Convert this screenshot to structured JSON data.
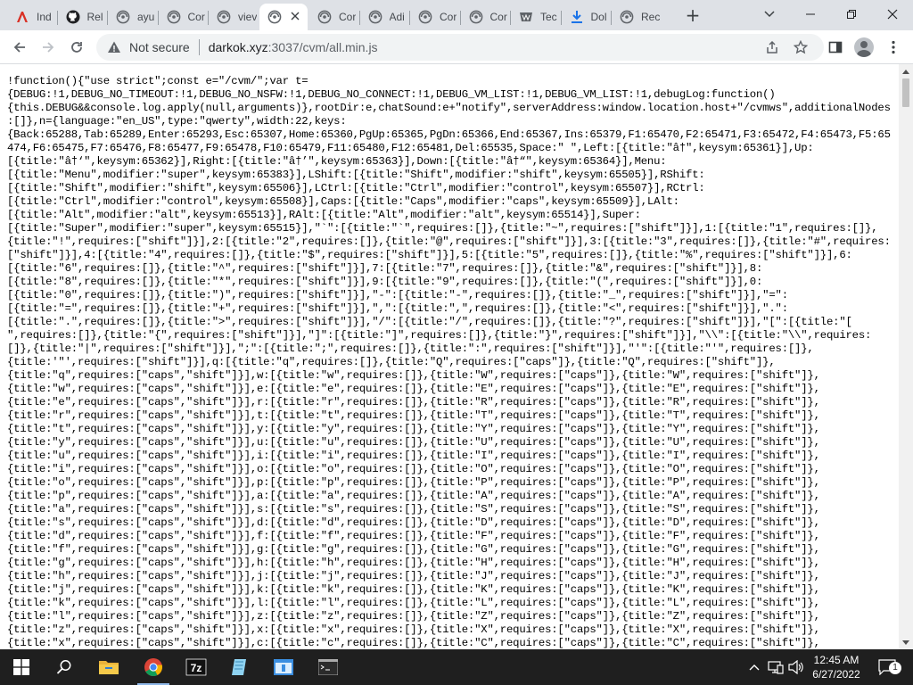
{
  "browser": {
    "tabs": [
      {
        "title": "Ind",
        "icon": "red-logo-icon",
        "active": false
      },
      {
        "title": "Rel",
        "icon": "github-icon",
        "active": false
      },
      {
        "title": "ayu",
        "icon": "globe-icon",
        "active": false
      },
      {
        "title": "Cor",
        "icon": "globe-icon",
        "active": false
      },
      {
        "title": "viev",
        "icon": "globe-icon",
        "active": false
      },
      {
        "title": "",
        "icon": "globe-icon",
        "active": true
      },
      {
        "title": "Cor",
        "icon": "globe-icon",
        "active": false
      },
      {
        "title": "Adi",
        "icon": "globe-icon",
        "active": false
      },
      {
        "title": "Cor",
        "icon": "globe-icon",
        "active": false
      },
      {
        "title": "Cor",
        "icon": "globe-icon",
        "active": false
      },
      {
        "title": "Tec",
        "icon": "tech-icon",
        "active": false
      },
      {
        "title": "Dol",
        "icon": "download-icon",
        "active": false
      },
      {
        "title": "Rec",
        "icon": "globe-icon",
        "active": false
      }
    ],
    "new_tab": "+",
    "omnibox": {
      "security_label": "Not secure",
      "url_host": "darkok.xyz",
      "url_path": ":3037/cvm/all.min.js"
    }
  },
  "content": {
    "lines": [
      "!function(){\"use strict\";const e=\"/cvm/\";var t=",
      "{DEBUG:!1,DEBUG_NO_TIMEOUT:!1,DEBUG_NO_NSFW:!1,DEBUG_NO_CONNECT:!1,DEBUG_VM_LIST:!1,DEBUG_VM_LIST:!1,debugLog:function()",
      "{this.DEBUG&&console.log.apply(null,arguments)},rootDir:e,chatSound:e+\"notify\",serverAddress:window.location.host+\"/cvmws\",additionalNodes",
      ":[]},n={language:\"en_US\",type:\"qwerty\",width:22,keys:",
      "{Back:65288,Tab:65289,Enter:65293,Esc:65307,Home:65360,PgUp:65365,PgDn:65366,End:65367,Ins:65379,F1:65470,F2:65471,F3:65472,F4:65473,F5:65",
      "474,F6:65475,F7:65476,F8:65477,F9:65478,F10:65479,F11:65480,F12:65481,Del:65535,Space:\" \",Left:[{title:\"â†\",keysym:65361}],Up:",
      "[{title:\"â†‘\",keysym:65362}],Right:[{title:\"â†’\",keysym:65363}],Down:[{title:\"â†“\",keysym:65364}],Menu:",
      "[{title:\"Menu\",modifier:\"super\",keysym:65383}],LShift:[{title:\"Shift\",modifier:\"shift\",keysym:65505}],RShift:",
      "[{title:\"Shift\",modifier:\"shift\",keysym:65506}],LCtrl:[{title:\"Ctrl\",modifier:\"control\",keysym:65507}],RCtrl:",
      "[{title:\"Ctrl\",modifier:\"control\",keysym:65508}],Caps:[{title:\"Caps\",modifier:\"caps\",keysym:65509}],LAlt:",
      "[{title:\"Alt\",modifier:\"alt\",keysym:65513}],RAlt:[{title:\"Alt\",modifier:\"alt\",keysym:65514}],Super:",
      "[{title:\"Super\",modifier:\"super\",keysym:65515}],\"`\":[{title:\"`\",requires:[]},{title:\"~\",requires:[\"shift\"]}],1:[{title:\"1\",requires:[]},",
      "{title:\"!\",requires:[\"shift\"]}],2:[{title:\"2\",requires:[]},{title:\"@\",requires:[\"shift\"]}],3:[{title:\"3\",requires:[]},{title:\"#\",requires:",
      "[\"shift\"]}],4:[{title:\"4\",requires:[]},{title:\"$\",requires:[\"shift\"]}],5:[{title:\"5\",requires:[]},{title:\"%\",requires:[\"shift\"]}],6:",
      "[{title:\"6\",requires:[]},{title:\"^\",requires:[\"shift\"]}],7:[{title:\"7\",requires:[]},{title:\"&\",requires:[\"shift\"]}],8:",
      "[{title:\"8\",requires:[]},{title:\"*\",requires:[\"shift\"]}],9:[{title:\"9\",requires:[]},{title:\"(\",requires:[\"shift\"]}],0:",
      "[{title:\"0\",requires:[]},{title:\")\",requires:[\"shift\"]}],\"-\":[{title:\"-\",requires:[]},{title:\"_\",requires:[\"shift\"]}],\"=\":",
      "[{title:\"=\",requires:[]},{title:\"+\",requires:[\"shift\"]}],\",\":[{title:\",\",requires:[]},{title:\"<\",requires:[\"shift\"]}],\".\":",
      "[{title:\".\",requires:[]},{title:\">\",requires:[\"shift\"]}],\"/\":[{title:\"/\",requires:[]},{title:\"?\",requires:[\"shift\"]}],\"[\":[{title:\"[",
      "\",requires:[]},{title:\"{\",requires:[\"shift\"]}],\"]\":[{title:\"]\",requires:[]},{title:\"}\",requires:[\"shift\"]}],\"\\\\\":[{title:\"\\\\\",requires:",
      "[]},{title:\"|\",requires:[\"shift\"]}],\";\":[{title:\";\",requires:[]},{title:\":\",requires:[\"shift\"]}],\"'\":[{title:\"'\",requires:[]},",
      "{title:'\"',requires:[\"shift\"]}],q:[{title:\"q\",requires:[]},{title:\"Q\",requires:[\"caps\"]},{title:\"Q\",requires:[\"shift\"]},",
      "{title:\"q\",requires:[\"caps\",\"shift\"]}],w:[{title:\"w\",requires:[]},{title:\"W\",requires:[\"caps\"]},{title:\"W\",requires:[\"shift\"]},",
      "{title:\"w\",requires:[\"caps\",\"shift\"]}],e:[{title:\"e\",requires:[]},{title:\"E\",requires:[\"caps\"]},{title:\"E\",requires:[\"shift\"]},",
      "{title:\"e\",requires:[\"caps\",\"shift\"]}],r:[{title:\"r\",requires:[]},{title:\"R\",requires:[\"caps\"]},{title:\"R\",requires:[\"shift\"]},",
      "{title:\"r\",requires:[\"caps\",\"shift\"]}],t:[{title:\"t\",requires:[]},{title:\"T\",requires:[\"caps\"]},{title:\"T\",requires:[\"shift\"]},",
      "{title:\"t\",requires:[\"caps\",\"shift\"]}],y:[{title:\"y\",requires:[]},{title:\"Y\",requires:[\"caps\"]},{title:\"Y\",requires:[\"shift\"]},",
      "{title:\"y\",requires:[\"caps\",\"shift\"]}],u:[{title:\"u\",requires:[]},{title:\"U\",requires:[\"caps\"]},{title:\"U\",requires:[\"shift\"]},",
      "{title:\"u\",requires:[\"caps\",\"shift\"]}],i:[{title:\"i\",requires:[]},{title:\"I\",requires:[\"caps\"]},{title:\"I\",requires:[\"shift\"]},",
      "{title:\"i\",requires:[\"caps\",\"shift\"]}],o:[{title:\"o\",requires:[]},{title:\"O\",requires:[\"caps\"]},{title:\"O\",requires:[\"shift\"]},",
      "{title:\"o\",requires:[\"caps\",\"shift\"]}],p:[{title:\"p\",requires:[]},{title:\"P\",requires:[\"caps\"]},{title:\"P\",requires:[\"shift\"]},",
      "{title:\"p\",requires:[\"caps\",\"shift\"]}],a:[{title:\"a\",requires:[]},{title:\"A\",requires:[\"caps\"]},{title:\"A\",requires:[\"shift\"]},",
      "{title:\"a\",requires:[\"caps\",\"shift\"]}],s:[{title:\"s\",requires:[]},{title:\"S\",requires:[\"caps\"]},{title:\"S\",requires:[\"shift\"]},",
      "{title:\"s\",requires:[\"caps\",\"shift\"]}],d:[{title:\"d\",requires:[]},{title:\"D\",requires:[\"caps\"]},{title:\"D\",requires:[\"shift\"]},",
      "{title:\"d\",requires:[\"caps\",\"shift\"]}],f:[{title:\"f\",requires:[]},{title:\"F\",requires:[\"caps\"]},{title:\"F\",requires:[\"shift\"]},",
      "{title:\"f\",requires:[\"caps\",\"shift\"]}],g:[{title:\"g\",requires:[]},{title:\"G\",requires:[\"caps\"]},{title:\"G\",requires:[\"shift\"]},",
      "{title:\"g\",requires:[\"caps\",\"shift\"]}],h:[{title:\"h\",requires:[]},{title:\"H\",requires:[\"caps\"]},{title:\"H\",requires:[\"shift\"]},",
      "{title:\"h\",requires:[\"caps\",\"shift\"]}],j:[{title:\"j\",requires:[]},{title:\"J\",requires:[\"caps\"]},{title:\"J\",requires:[\"shift\"]},",
      "{title:\"j\",requires:[\"caps\",\"shift\"]}],k:[{title:\"k\",requires:[]},{title:\"K\",requires:[\"caps\"]},{title:\"K\",requires:[\"shift\"]},",
      "{title:\"k\",requires:[\"caps\",\"shift\"]}],l:[{title:\"l\",requires:[]},{title:\"L\",requires:[\"caps\"]},{title:\"L\",requires:[\"shift\"]},",
      "{title:\"l\",requires:[\"caps\",\"shift\"]}],z:[{title:\"z\",requires:[]},{title:\"Z\",requires:[\"caps\"]},{title:\"Z\",requires:[\"shift\"]},",
      "{title:\"z\",requires:[\"caps\",\"shift\"]}],x:[{title:\"x\",requires:[]},{title:\"X\",requires:[\"caps\"]},{title:\"X\",requires:[\"shift\"]},",
      "{title:\"x\",requires:[\"caps\",\"shift\"]}],c:[{title:\"c\",requires:[]},{title:\"C\",requires:[\"caps\"]},{title:\"C\",requires:[\"shift\"]},"
    ]
  },
  "taskbar": {
    "apps": [
      {
        "name": "search-icon"
      },
      {
        "name": "file-explorer-icon"
      },
      {
        "name": "chrome-icon",
        "active": true
      },
      {
        "name": "7zip-icon"
      },
      {
        "name": "notepad-icon"
      },
      {
        "name": "window-app-icon"
      },
      {
        "name": "terminal-icon"
      }
    ],
    "clock": {
      "time": "12:45 AM",
      "date": "6/27/2022"
    },
    "notification_count": "1"
  },
  "colors": {
    "tab_strip": "#dee1e6",
    "taskbar": "#1f1f1f",
    "accent_active": "#8fb8e8",
    "github_red": "#d93025"
  }
}
